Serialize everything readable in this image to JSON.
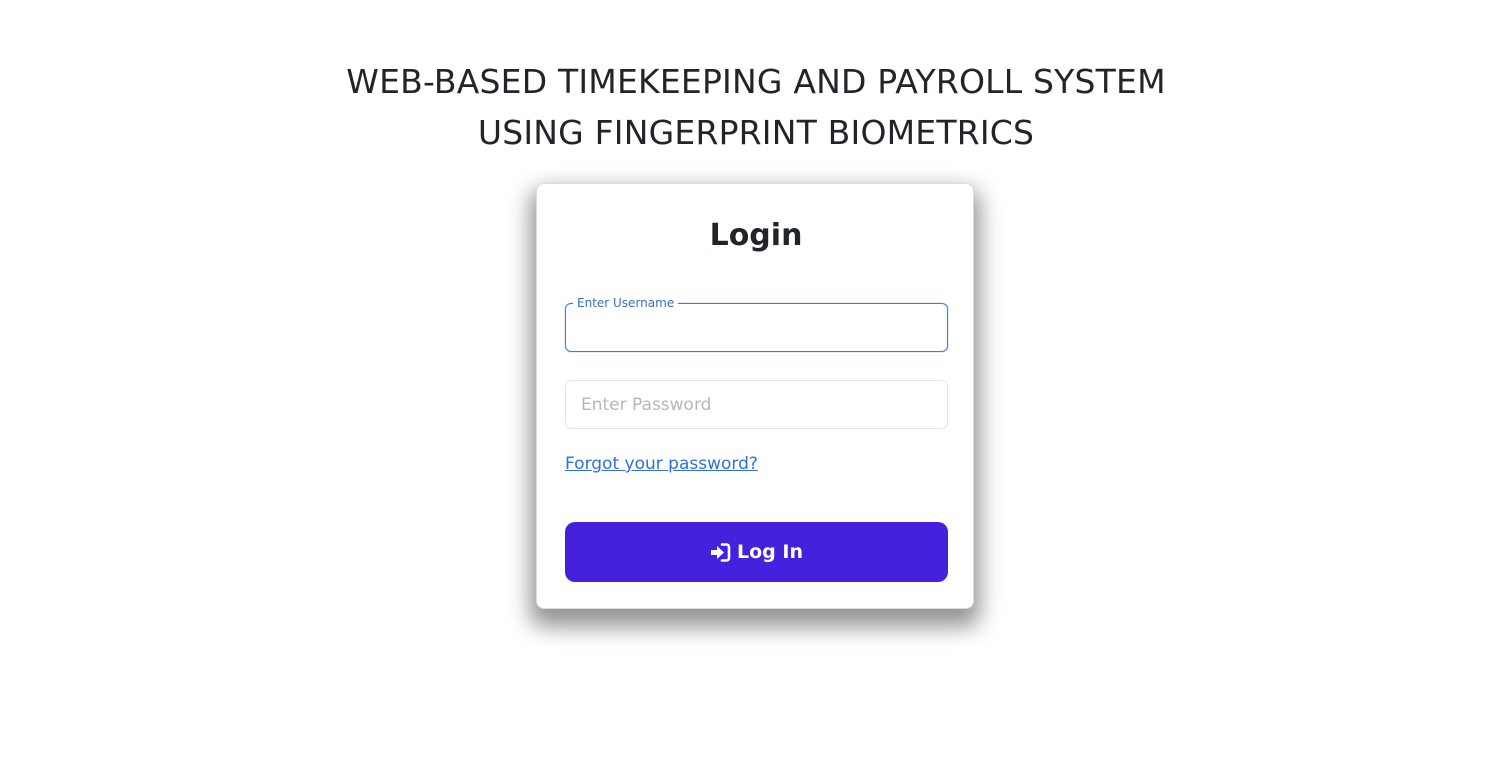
{
  "header": {
    "title_line1": "WEB-BASED TIMEKEEPING AND PAYROLL SYSTEM",
    "title_line2": "USING FINGERPRINT BIOMETRICS"
  },
  "login_card": {
    "heading": "Login",
    "username": {
      "label": "Enter Username",
      "value": ""
    },
    "password": {
      "placeholder": "Enter Password",
      "value": ""
    },
    "forgot_link": "Forgot your password?",
    "login_button": {
      "label": "Log In",
      "icon": "sign-in-icon"
    }
  },
  "colors": {
    "primary_button": "#4621dd",
    "link": "#2f6fe0",
    "focus_border": "#3d7fd6",
    "text": "#212529"
  }
}
